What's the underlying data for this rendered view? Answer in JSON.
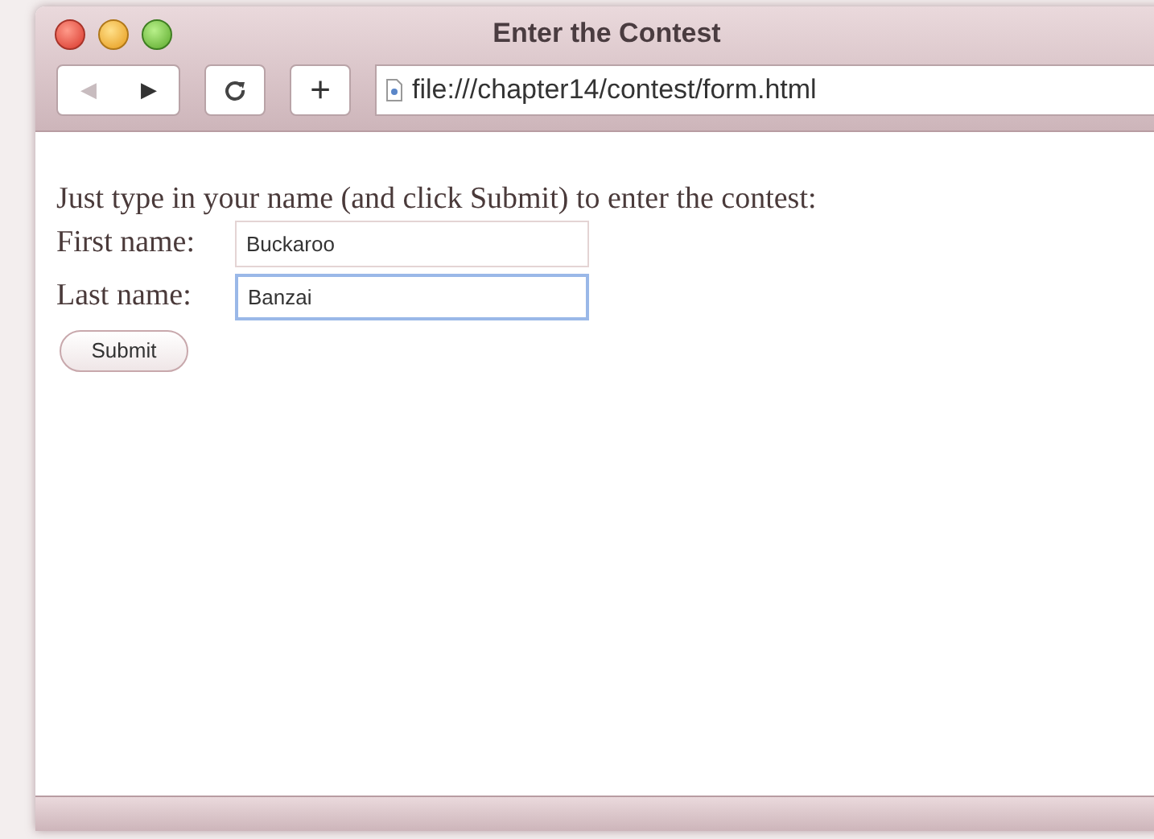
{
  "window": {
    "title": "Enter the Contest"
  },
  "toolbar": {
    "back": "◀",
    "forward": "▶",
    "add": "+",
    "address": "file:///chapter14/contest/form.html"
  },
  "page": {
    "intro": "Just type in your name (and click Submit) to enter the contest:",
    "fields": [
      {
        "label": "First name:",
        "value": "Buckaroo",
        "focused": false
      },
      {
        "label": "Last name:",
        "value": "Banzai",
        "focused": true
      }
    ],
    "submit": "Submit"
  }
}
